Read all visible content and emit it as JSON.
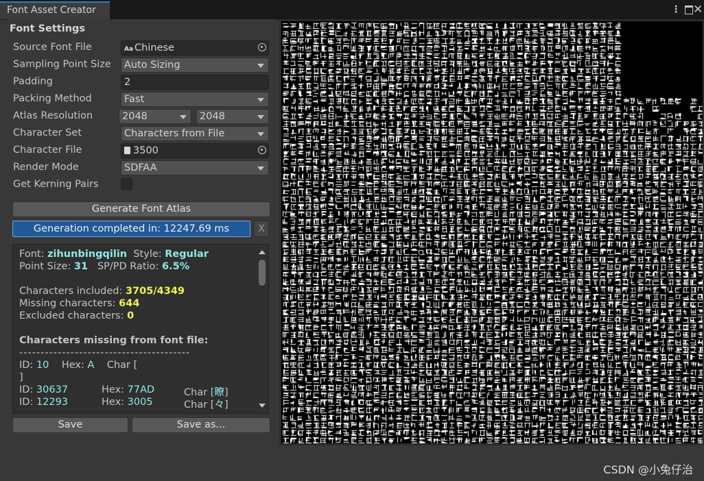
{
  "window": {
    "tab_title": "Font Asset Creator",
    "controls": [
      "kebab-menu",
      "maximize",
      "close"
    ],
    "close_glyph": "✕",
    "kebab_glyph": "⋮"
  },
  "settings": {
    "section_title": "Font Settings",
    "source_font_file": {
      "label": "Source Font File",
      "icon": "Aa",
      "value": "Chinese"
    },
    "sampling_point_size": {
      "label": "Sampling Point Size",
      "value": "Auto Sizing"
    },
    "padding": {
      "label": "Padding",
      "value": "2"
    },
    "packing_method": {
      "label": "Packing Method",
      "value": "Fast"
    },
    "atlas_resolution": {
      "label": "Atlas Resolution",
      "width": "2048",
      "height": "2048"
    },
    "character_set": {
      "label": "Character Set",
      "value": "Characters from File"
    },
    "character_file": {
      "label": "Character File",
      "value": "3500"
    },
    "render_mode": {
      "label": "Render Mode",
      "value": "SDFAA"
    },
    "kerning": {
      "label": "Get Kerning Pairs",
      "checked": false
    }
  },
  "actions": {
    "generate_label": "Generate Font Atlas",
    "progress_text": "Generation completed in: 12247.69 ms",
    "progress_fraction": 1.0,
    "cancel_label": "X",
    "save_label": "Save",
    "save_as_label": "Save as..."
  },
  "report": {
    "font_label": "Font: ",
    "font_name": "zihunbingqilin",
    "style_label": "Style: ",
    "style_value": "Regular",
    "point_size_label": "Point Size: ",
    "point_size_value": "31",
    "ratio_label": "SP/PD Ratio: ",
    "ratio_value": "6.5%",
    "included_label": "Characters included: ",
    "included_value": "3705/4349",
    "missing_label": "Missing characters: ",
    "missing_value": "644",
    "excluded_label": "Excluded characters: ",
    "excluded_value": "0",
    "missing_header": "Characters missing from font file:",
    "divider": "----------------------------------------",
    "entries": [
      {
        "id_label": "ID: ",
        "id": "10",
        "hex_label": "Hex: ",
        "hex": "A",
        "char_label": "Char [",
        "char": "",
        "close": "]"
      },
      {
        "id_label": "ID: ",
        "id": "30637",
        "hex_label": "Hex: ",
        "hex": "77AD",
        "char_label": "Char [",
        "char": "瞭",
        "close": "]"
      },
      {
        "id_label": "ID: ",
        "id": "12293",
        "hex_label": "Hex: ",
        "hex": "3005",
        "char_label": "Char [",
        "char": "々",
        "close": "]"
      }
    ]
  },
  "atlas_preview": {
    "description_hidden": true,
    "glyph_color": "#ffffff",
    "background_color": "#000000"
  },
  "watermark": "CSDN @小兔仔治",
  "colors": {
    "accent": "#3a79bb",
    "progress_fill": "#215a98",
    "highlight_cyan": "#8fe8e8",
    "highlight_yellow": "#f2f252"
  }
}
